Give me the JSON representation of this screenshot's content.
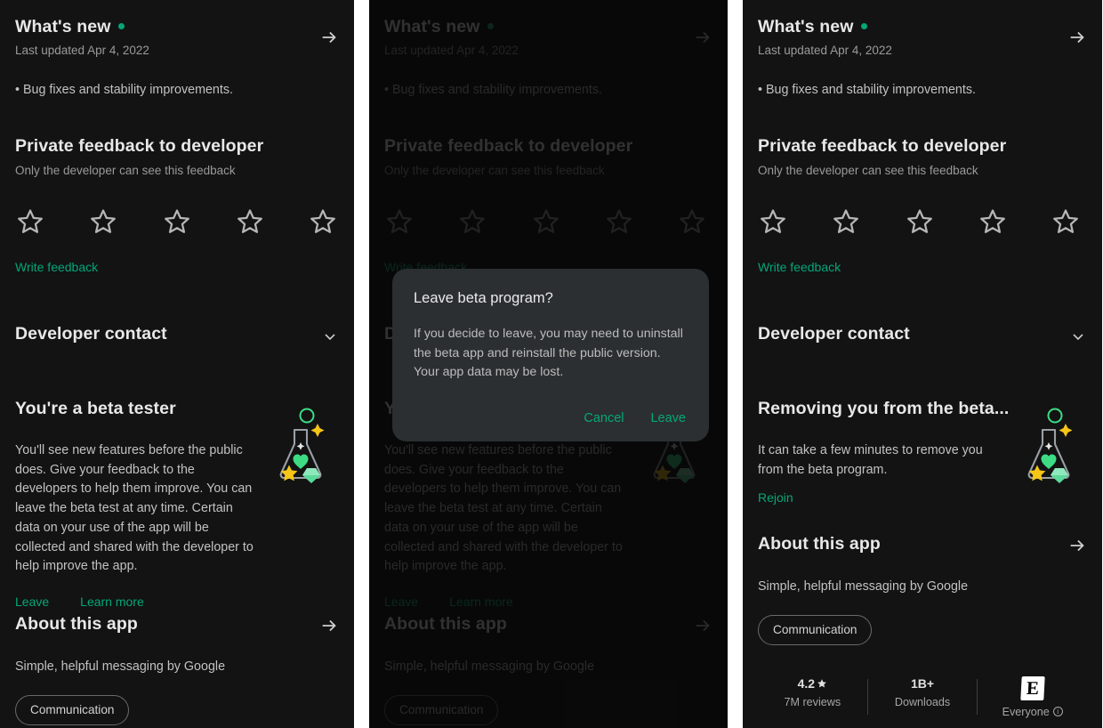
{
  "app": {
    "accent_color": "#04a777",
    "background_color": "#131313",
    "dialog_background": "#2b2f31"
  },
  "whats_new": {
    "title": "What's new",
    "updated": "Last updated Apr 4, 2022",
    "note": "• Bug fixes and stability improvements.",
    "arrow_icon": "arrow-right-icon",
    "new_dot": "green-dot-icon"
  },
  "private_feedback": {
    "title": "Private feedback to developer",
    "subtitle": "Only the developer can see this feedback",
    "rating_value": 0,
    "stars": [
      "1",
      "2",
      "3",
      "4",
      "5"
    ],
    "write_link": "Write feedback"
  },
  "developer_contact": {
    "title": "Developer contact",
    "chevron_icon": "chevron-down-icon"
  },
  "beta_tester": {
    "title": "You're a beta tester",
    "body": "You'll see new features before the public does. Give your feedback to the developers to help them improve. You can leave the beta test at any time. Certain data on your use of the app will be collected and shared with the developer to help improve the app.",
    "leave_link": "Leave",
    "learn_more_link": "Learn more",
    "illustration": "beaker-icon"
  },
  "removing_beta": {
    "title": "Removing you from the beta...",
    "body": "It can take a few minutes to remove you from the beta program.",
    "rejoin_link": "Rejoin",
    "illustration": "beaker-icon"
  },
  "about_app": {
    "title": "About this app",
    "description": "Simple, helpful messaging by Google",
    "category_chip": "Communication",
    "arrow_icon": "arrow-right-icon"
  },
  "stats": {
    "rating": {
      "value": "4.2",
      "star_icon": "star-filled-icon",
      "label": "7M reviews"
    },
    "downloads": {
      "value": "1B+",
      "label": "Downloads"
    },
    "content_rating": {
      "badge": "E",
      "label": "Everyone",
      "info_icon": "info-icon"
    }
  },
  "dialog": {
    "title": "Leave beta program?",
    "body": "If you decide to leave, you may need to uninstall the beta app and reinstall the public version. Your app data may be lost.",
    "cancel_label": "Cancel",
    "leave_label": "Leave"
  }
}
